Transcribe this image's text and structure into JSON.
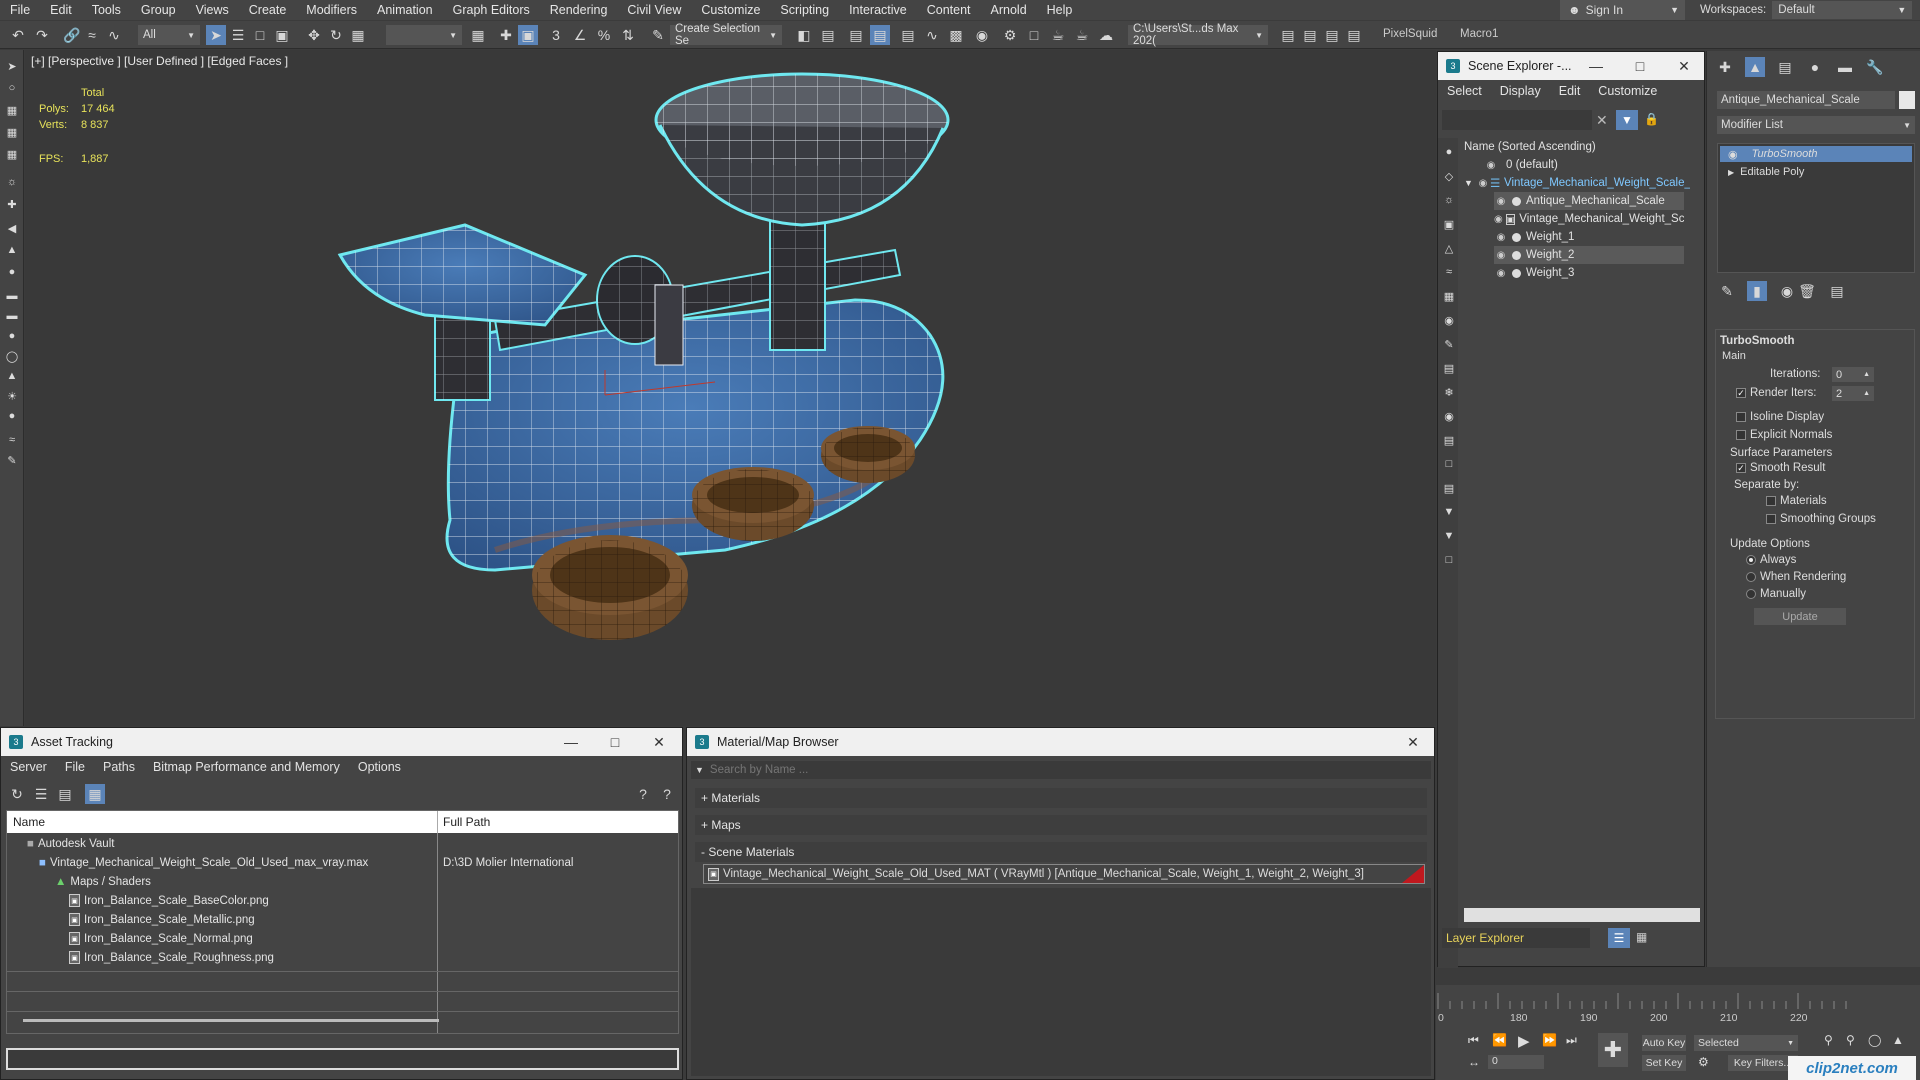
{
  "menu": [
    "File",
    "Edit",
    "Tools",
    "Group",
    "Views",
    "Create",
    "Modifiers",
    "Animation",
    "Graph Editors",
    "Rendering",
    "Civil View",
    "Customize",
    "Scripting",
    "Interactive",
    "Content",
    "Arnold",
    "Help"
  ],
  "signin": "Sign In",
  "workspaces": {
    "label": "Workspaces:",
    "value": "Default"
  },
  "toolbar": {
    "filter": "All",
    "selection_set": "Create Selection Se",
    "path": "C:\\Users\\St...ds Max 202(",
    "pixelsquid": "PixelSquid",
    "macro": "Macro1"
  },
  "viewport": {
    "label": "[+] [Perspective ] [User Defined ] [Edged Faces ]",
    "stats": {
      "total": "Total",
      "polys_label": "Polys:",
      "polys": "17 464",
      "verts_label": "Verts:",
      "verts": "8 837",
      "fps_label": "FPS:",
      "fps": "1,887"
    }
  },
  "scene_explorer": {
    "title": "Scene Explorer -...",
    "menu": [
      "Select",
      "Display",
      "Edit",
      "Customize"
    ],
    "column": "Name (Sorted Ascending)",
    "rows": [
      {
        "label": "0 (default)"
      },
      {
        "label": "Vintage_Mechanical_Weight_Scale_Ol"
      },
      {
        "label": "Antique_Mechanical_Scale"
      },
      {
        "label": "Vintage_Mechanical_Weight_Scale"
      },
      {
        "label": "Weight_1"
      },
      {
        "label": "Weight_2"
      },
      {
        "label": "Weight_3"
      }
    ],
    "layer_explorer": "Layer Explorer"
  },
  "command_panel": {
    "object_name": "Antique_Mechanical_Scale",
    "modifier_list": "Modifier List",
    "stack": [
      "TurboSmooth",
      "Editable Poly"
    ],
    "rollout": "TurboSmooth",
    "main": "Main",
    "iterations_label": "Iterations:",
    "iterations": "0",
    "render_iters_label": "Render Iters:",
    "render_iters": "2",
    "isoline": "Isoline Display",
    "explicit_normals": "Explicit Normals",
    "surface_params": "Surface Parameters",
    "smooth_result": "Smooth Result",
    "separate_by": "Separate by:",
    "materials": "Materials",
    "smoothing_groups": "Smoothing Groups",
    "update_options": "Update Options",
    "always": "Always",
    "when_rendering": "When Rendering",
    "manually": "Manually",
    "update": "Update"
  },
  "asset_tracking": {
    "title": "Asset Tracking",
    "menu": [
      "Server",
      "File",
      "Paths",
      "Bitmap Performance and Memory",
      "Options"
    ],
    "col_name": "Name",
    "col_path": "Full Path",
    "rows": [
      {
        "name": "Autodesk Vault",
        "path": ""
      },
      {
        "name": "Vintage_Mechanical_Weight_Scale_Old_Used_max_vray.max",
        "path": "D:\\3D Molier International"
      },
      {
        "name": "Maps / Shaders",
        "path": ""
      },
      {
        "name": "Iron_Balance_Scale_BaseColor.png",
        "path": ""
      },
      {
        "name": "Iron_Balance_Scale_Metallic.png",
        "path": ""
      },
      {
        "name": "Iron_Balance_Scale_Normal.png",
        "path": ""
      },
      {
        "name": "Iron_Balance_Scale_Roughness.png",
        "path": ""
      }
    ]
  },
  "material_browser": {
    "title": "Material/Map Browser",
    "search_placeholder": "Search by Name ...",
    "groups": [
      "+ Materials",
      "+ Maps",
      "- Scene Materials"
    ],
    "scene_material": "Vintage_Mechanical_Weight_Scale_Old_Used_MAT  ( VRayMtl )  [Antique_Mechanical_Scale, Weight_1, Weight_2, Weight_3]"
  },
  "timeline": {
    "ticks": [
      "0",
      "180",
      "190",
      "200",
      "210",
      "220"
    ],
    "auto_key": "Auto Key",
    "set_key": "Set Key",
    "selected": "Selected",
    "key_filters": "Key Filters...",
    "frame": "0"
  },
  "watermark": "clip2net.com",
  "colors": {
    "accent": "#5b84b8",
    "selection_outline": "#6fe8f0",
    "scale_blue": "#3f6fa8",
    "wood": "#6b4a2a"
  }
}
